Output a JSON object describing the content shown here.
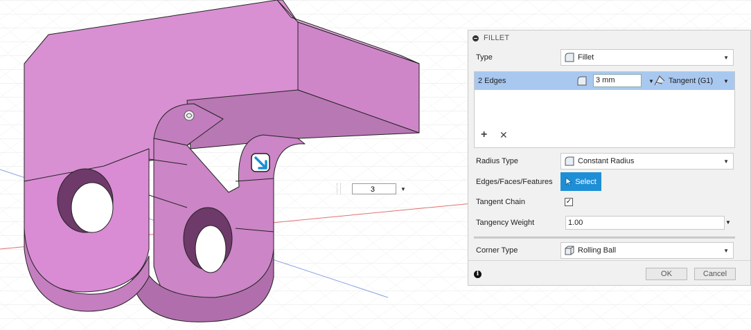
{
  "viewport": {
    "inline_radius_value": "3",
    "body_color": "#d98cd4",
    "edge_color": "#222222",
    "grid_color": "#e2e2e2",
    "axis_x_color": "#e07070",
    "axis_y_color": "#8aa0e0",
    "cursor_color": "#1b8fd6"
  },
  "panel": {
    "title": "FILLET",
    "type_label": "Type",
    "type_value": "Fillet",
    "edges_label": "2 Edges",
    "radius_value": "3 mm",
    "continuity_value": "Tangent (G1)",
    "radius_type_label": "Radius Type",
    "radius_type_value": "Constant Radius",
    "selection_label": "Edges/Faces/Features",
    "select_button": "Select",
    "tangent_chain_label": "Tangent Chain",
    "tangent_chain_checked": true,
    "tangency_weight_label": "Tangency Weight",
    "tangency_weight_value": "1.00",
    "corner_type_label": "Corner Type",
    "corner_type_value": "Rolling Ball",
    "ok_button": "OK",
    "cancel_button": "Cancel",
    "accent_color": "#1e8fd6",
    "selected_row_color": "#a9c8f0"
  }
}
